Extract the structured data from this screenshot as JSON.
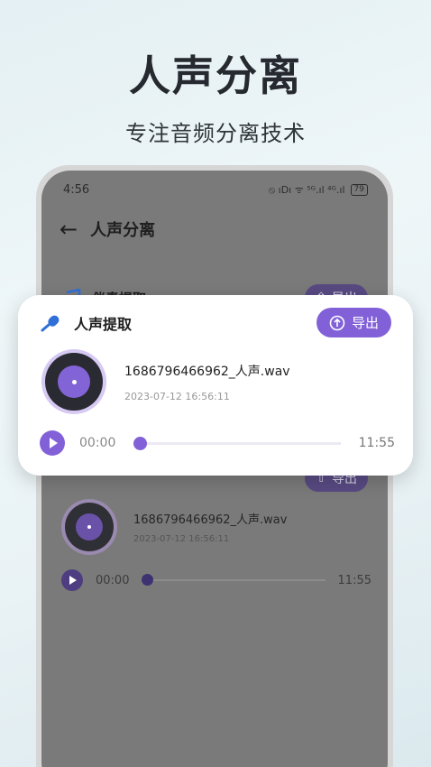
{
  "hero": {
    "title": "人声分离",
    "subtitle": "专注音频分离技术"
  },
  "status_bar": {
    "time": "4:56",
    "icons": "⦸ ıDı ᯤ ⁵ᴳ.ıl ⁴ᴳ.ıl",
    "battery": "79"
  },
  "nav": {
    "back": "←",
    "title": "人声分离"
  },
  "sections": {
    "accompaniment": {
      "label": "伴奏提取",
      "export": "导出"
    },
    "vocal_bg": {
      "export": "导出"
    }
  },
  "background_file": {
    "name": "1686796466962_人声.wav",
    "date": "2023-07-12 16:56:11",
    "current_time": "00:00",
    "total_time": "11:55"
  },
  "card": {
    "label": "人声提取",
    "export": "导出",
    "file_name": "1686796466962_人声.wav",
    "file_date": "2023-07-12 16:56:11",
    "current_time": "00:00",
    "total_time": "11:55"
  },
  "colors": {
    "accent": "#8261d8",
    "overlay": "#7a7a7a"
  },
  "icons": {
    "vocal": "microphone-icon",
    "accompaniment": "music-note-icon",
    "export": "upload-icon",
    "play": "play-icon",
    "back": "arrow-left-icon"
  }
}
